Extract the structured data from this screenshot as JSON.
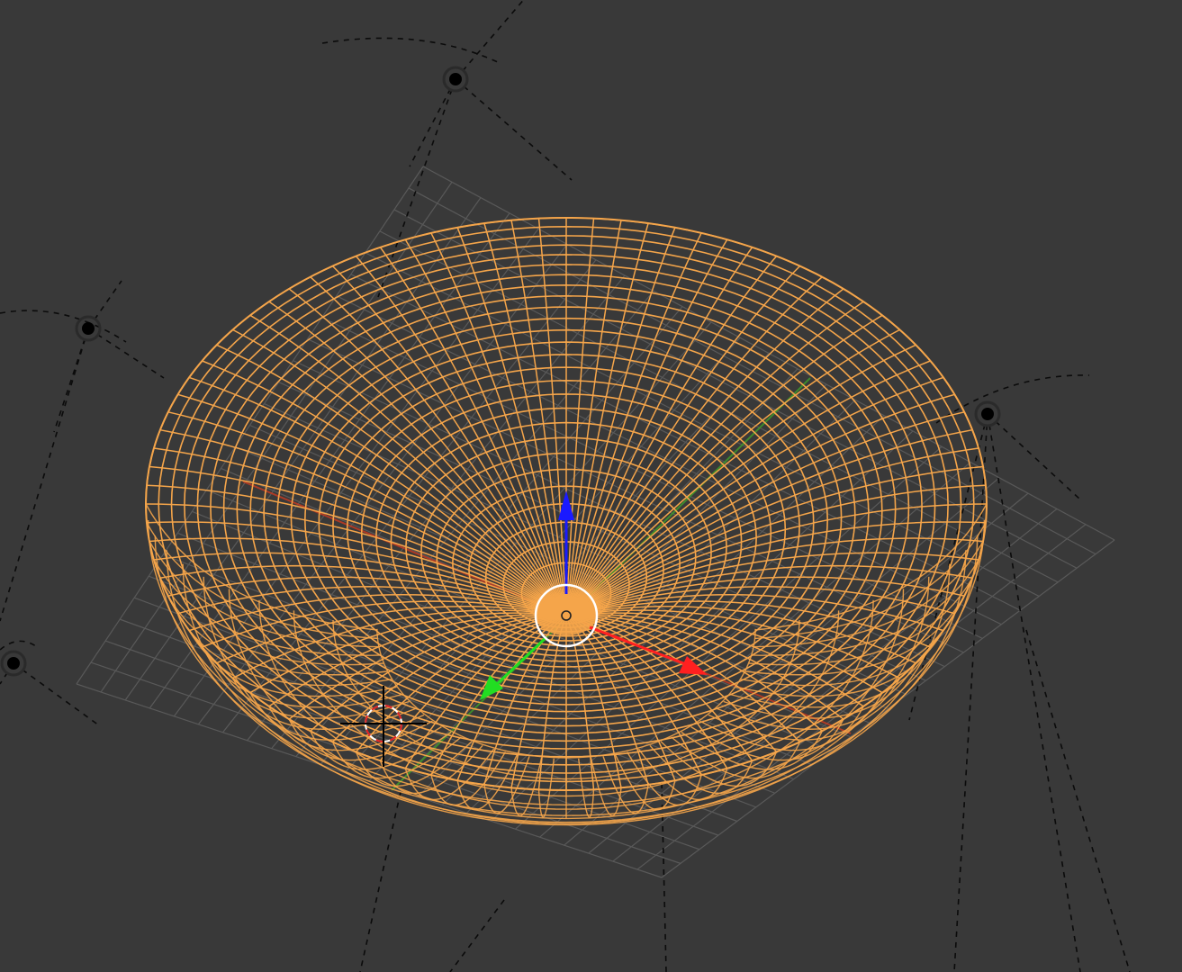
{
  "editor": "3d-viewport",
  "view": {
    "shading": "wireframe",
    "projection": "perspective",
    "background_color": "#393939"
  },
  "colors": {
    "background": "#393939",
    "selected_wire": "#f5a54a",
    "grid": "#595959",
    "axis_x": "#c23b22",
    "axis_y": "#3f9a2a",
    "gizmo_x": "#ff2020",
    "gizmo_y": "#22dd22",
    "gizmo_z": "#1a1aff",
    "origin_ring": "#ffffff",
    "lamp": "#000000"
  },
  "selected_object": {
    "type": "mesh",
    "shape": "bowl",
    "select_state": "active"
  },
  "manipulator": {
    "mode": "translate",
    "axes": [
      "x",
      "y",
      "z"
    ]
  },
  "lamps": [
    {
      "name": "lamp-top",
      "type": "point"
    },
    {
      "name": "lamp-left",
      "type": "point"
    },
    {
      "name": "lamp-right",
      "type": "point"
    },
    {
      "name": "lamp-bottom-left",
      "type": "point"
    }
  ],
  "cursor": {
    "type": "3d-cursor"
  },
  "icons": [
    "lamp-icon",
    "3d-cursor-icon",
    "origin-icon",
    "translate-gizmo-icon"
  ]
}
